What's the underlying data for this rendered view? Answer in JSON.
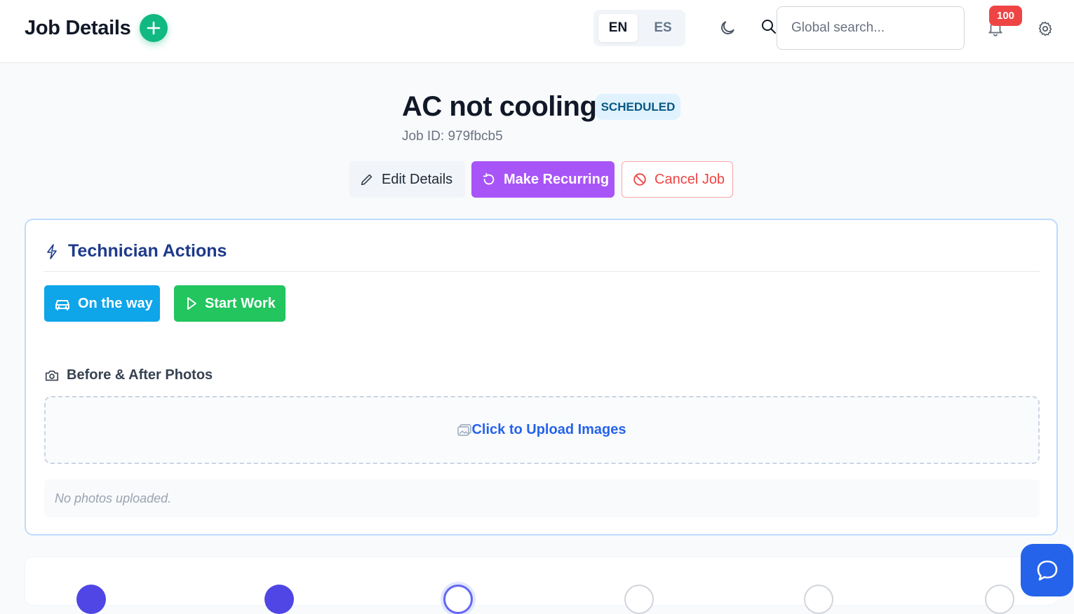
{
  "header": {
    "title": "Job Details",
    "languages": [
      "EN",
      "ES"
    ],
    "active_language": "EN",
    "search_placeholder": "Global search...",
    "notification_count": "100"
  },
  "job": {
    "title": "AC not cooling",
    "status": "SCHEDULED",
    "id_label": "Job ID: 979fbcb5"
  },
  "actions": {
    "edit": "Edit Details",
    "recurring": "Make Recurring",
    "cancel": "Cancel Job"
  },
  "technician": {
    "heading": "Technician Actions",
    "on_the_way": "On the way",
    "start_work": "Start Work",
    "photos_heading": "Before & After Photos",
    "upload_label": "Click to Upload Images",
    "no_photos": "No photos uploaded."
  },
  "progress": {
    "steps": [
      "done",
      "done",
      "current",
      "pending",
      "pending",
      "pending"
    ]
  },
  "colors": {
    "accent_green": "#10b981",
    "recurring_purple": "#a855f7",
    "cancel_red": "#ef4444",
    "status_bg": "#e0f2fe",
    "on_the_way_blue": "#0ea5e9",
    "start_work_green": "#22c55e",
    "step_done": "#4f46e5",
    "chat_blue": "#2563eb"
  },
  "icons": {
    "add": "plus-icon",
    "theme": "moon-icon",
    "search": "search-icon",
    "notifications": "bell-icon",
    "settings": "gear-icon",
    "edit": "pencil-icon",
    "recurring": "rotate-icon",
    "cancel": "ban-icon",
    "technician": "lightning-icon",
    "on_the_way": "car-icon",
    "start_work": "play-icon",
    "photos": "camera-icon",
    "upload": "image-icon",
    "chat": "chat-icon"
  }
}
